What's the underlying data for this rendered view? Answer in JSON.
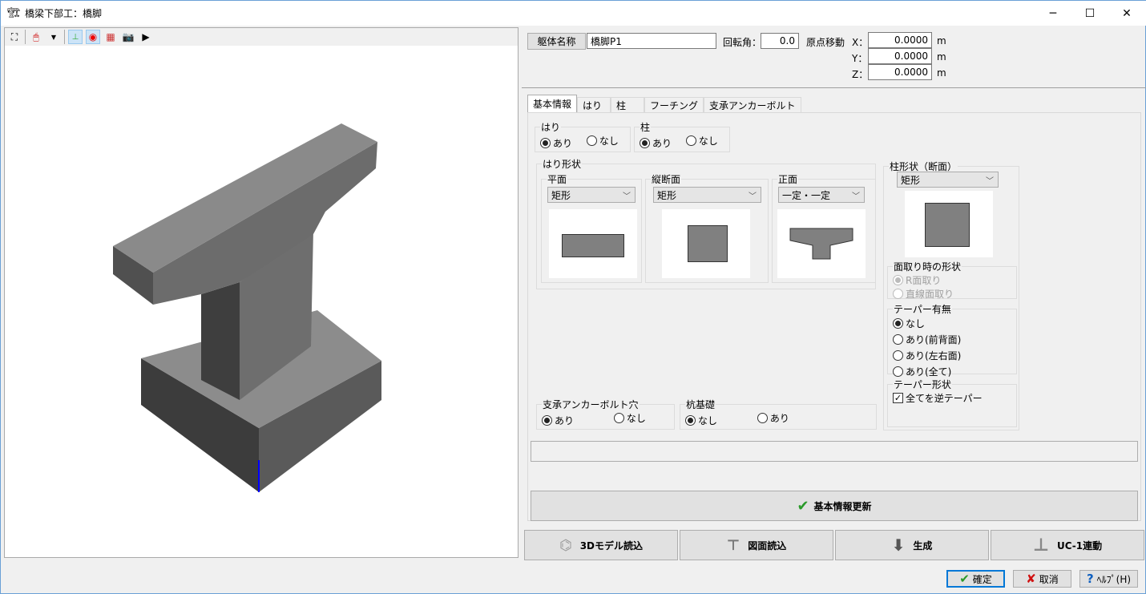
{
  "window": {
    "title": "橋梁下部工：橋脚",
    "minimize": "─",
    "maximize": "☐",
    "close": "✕"
  },
  "toolbar": {
    "icons": [
      "fit-view-icon",
      "mouse-mode-icon",
      "dropdown-icon",
      "axis-icon",
      "target-icon",
      "color-palette-icon",
      "camera-icon",
      "movie-icon"
    ]
  },
  "header": {
    "body_name_label": "躯体名称",
    "body_name_value": "橋脚P1",
    "rotation_label": "回転角：",
    "rotation_value": "0.0",
    "origin_label": "原点移動",
    "x_label": "X：",
    "y_label": "Y：",
    "z_label": "Z：",
    "x_value": "0.0000",
    "y_value": "0.0000",
    "z_value": "0.0000",
    "unit": "m"
  },
  "tabs": [
    "基本情報",
    "はり",
    "柱",
    "フーチング",
    "支承アンカーボルト"
  ],
  "basic": {
    "beam_group": "はり",
    "col_group": "柱",
    "yes": "あり",
    "no": "なし",
    "beam_shape_group": "はり形状",
    "plan_label": "平面",
    "plan_value": "矩形",
    "longi_label": "縦断面",
    "longi_value": "矩形",
    "front_label": "正面",
    "front_value": "一定・一定",
    "col_shape_label": "柱形状（断面）",
    "col_shape_value": "矩形",
    "chamfer_group": "面取り時の形状",
    "chamfer_r": "R面取り",
    "chamfer_line": "直線面取り",
    "taper_group": "テーパー有無",
    "taper_none": "なし",
    "taper_fb": "あり(前背面)",
    "taper_lr": "あり(左右面)",
    "taper_all": "あり(全て)",
    "taper_shape_group": "テーパー形状",
    "taper_reverse": "全てを逆テーパー",
    "anchor_group": "支承アンカーボルト穴",
    "pile_group": "杭基礎",
    "pile_none": "なし",
    "pile_yes": "あり",
    "update_button": "基本情報更新"
  },
  "actions": {
    "load3d": "3Dモデル読込",
    "loaddrawing": "図面読込",
    "generate": "生成",
    "uc1": "UC-1連動"
  },
  "footer": {
    "ok": "確定",
    "cancel": "取消",
    "help": "ﾍﾙﾌﾟ(H)"
  }
}
